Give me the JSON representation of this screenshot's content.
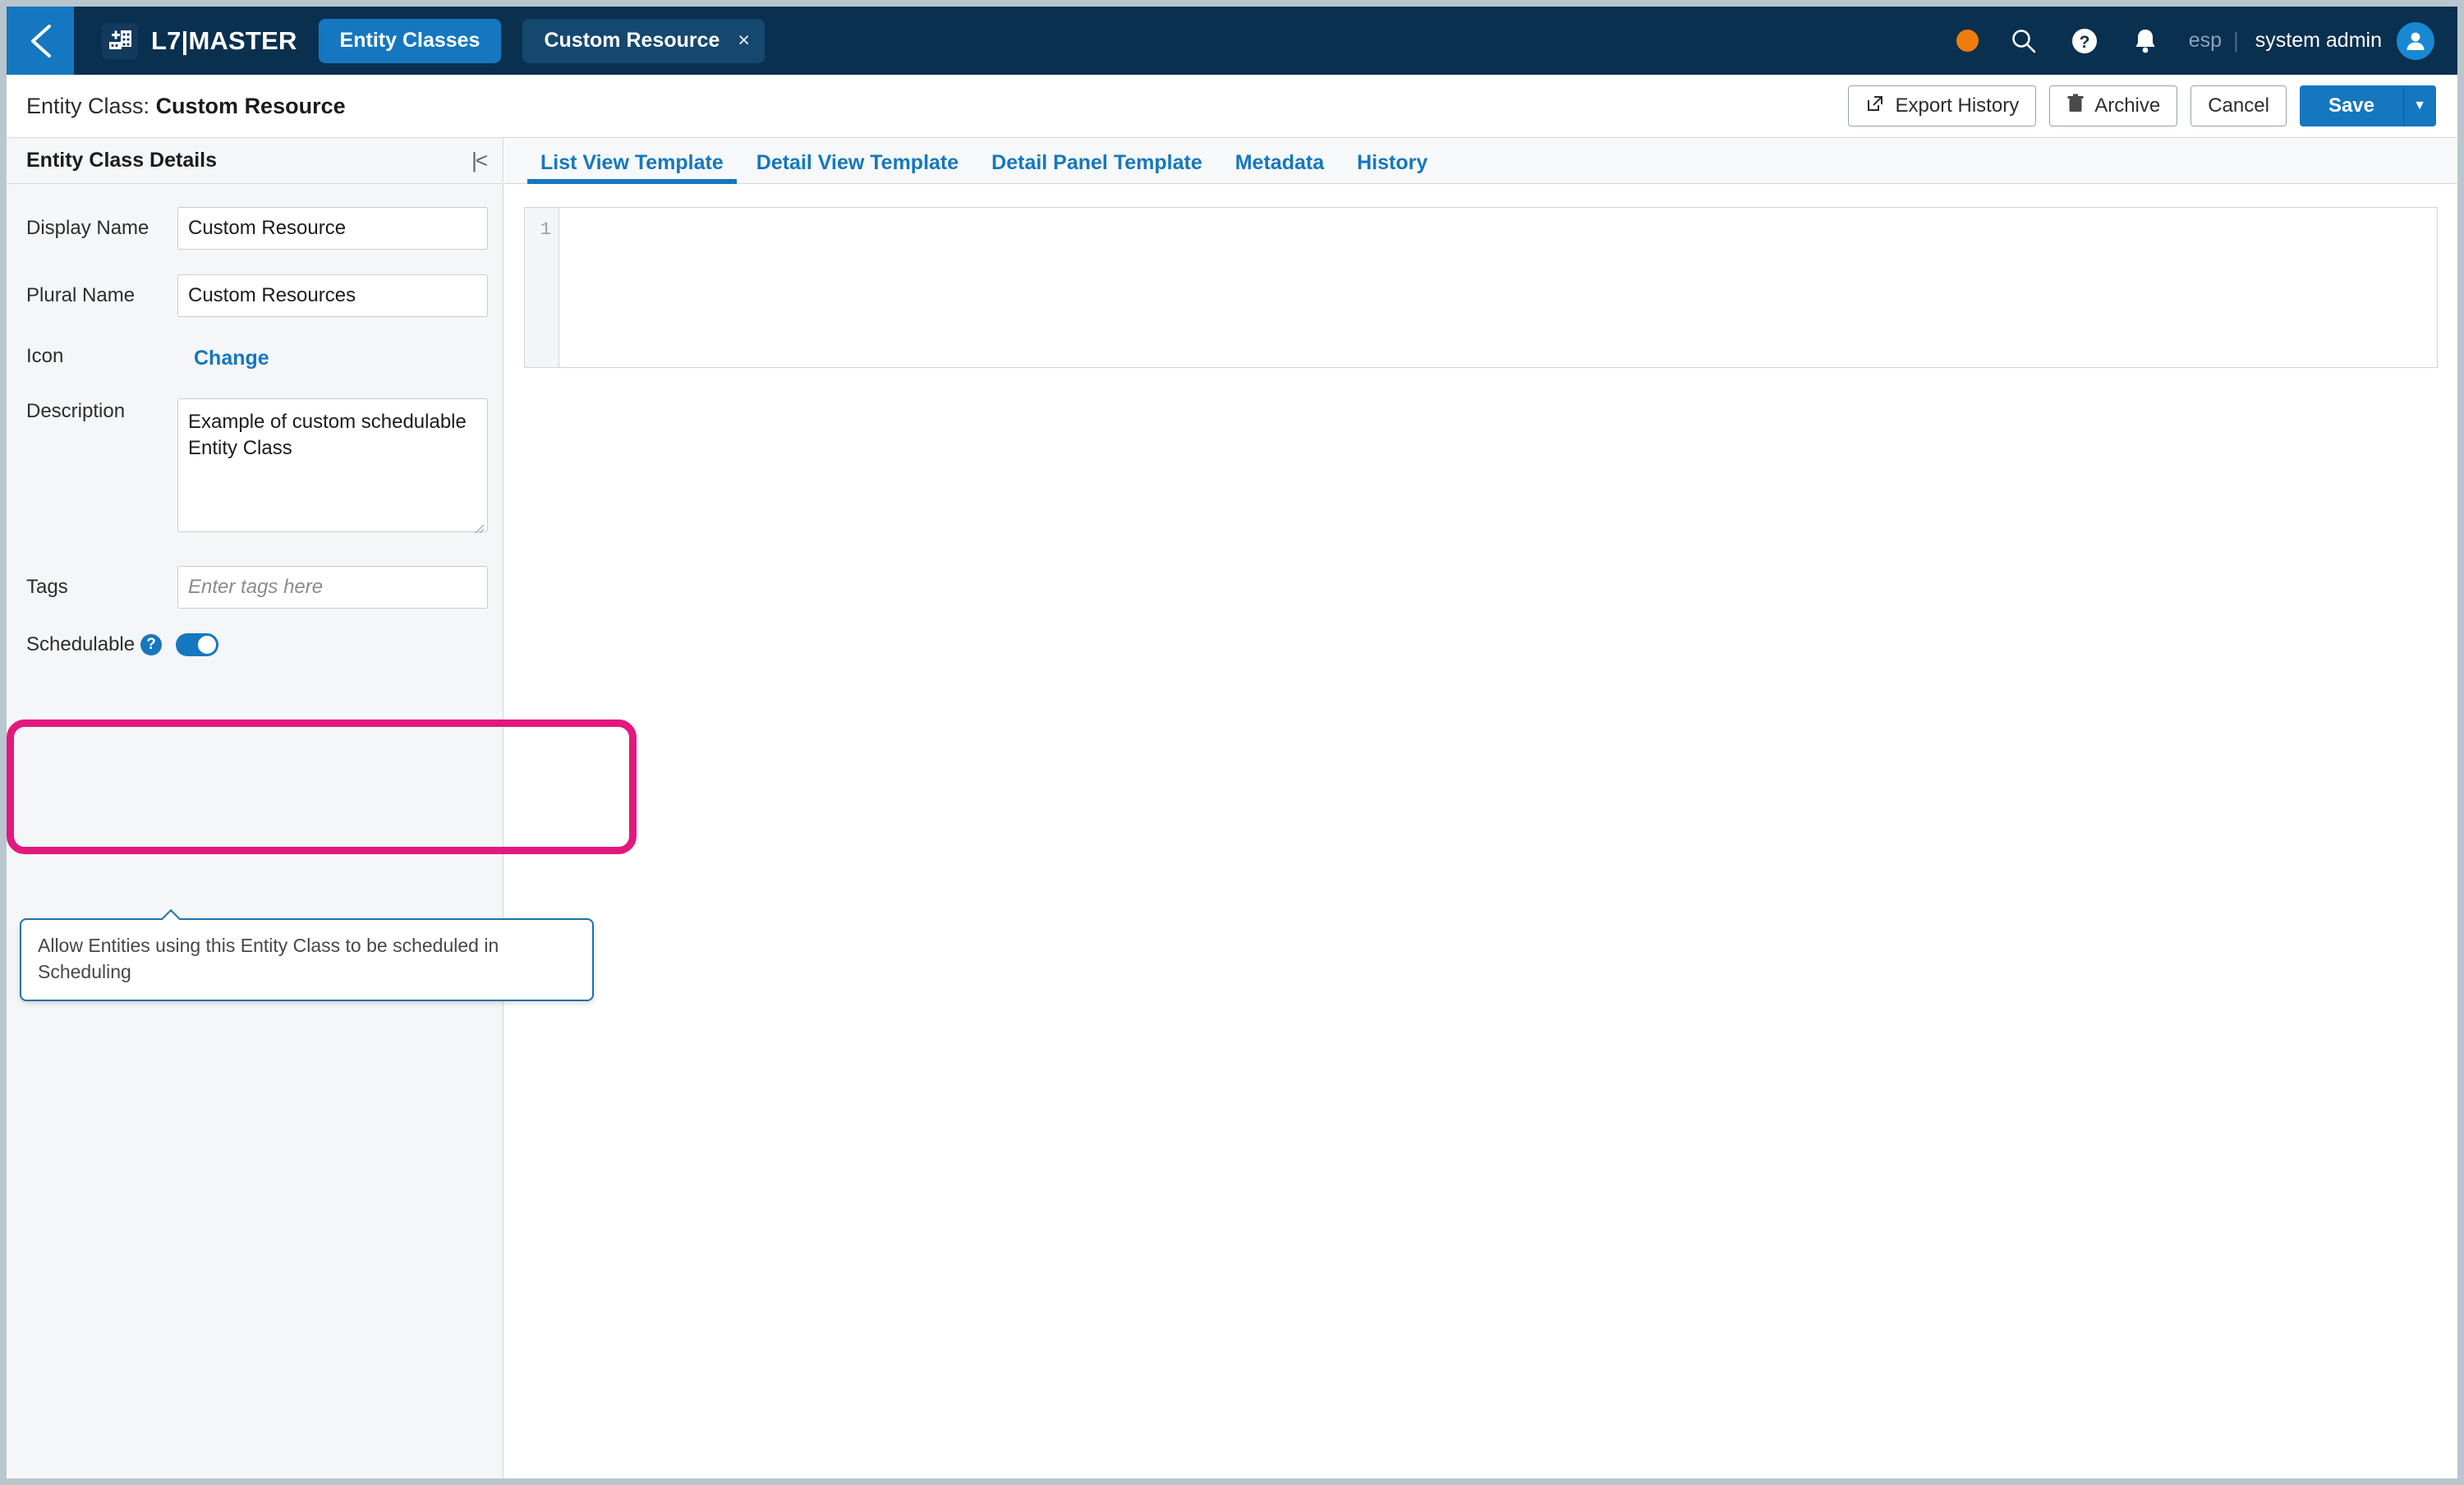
{
  "topbar": {
    "back_icon": "chevron-left-icon",
    "logo_icon": "lab-building-icon",
    "brand": "L7|MASTER",
    "nav_tab": "Entity Classes",
    "doc_tab": "Custom Resource",
    "doc_tab_close": "×",
    "status_dot_color": "#ef7d0e",
    "search_icon": "search-icon",
    "help_icon": "help-circle-icon",
    "notification_icon": "bell-icon",
    "tenant": "esp",
    "separator": "|",
    "user": "system admin",
    "avatar_icon": "user-avatar-icon"
  },
  "subbar": {
    "title_prefix": "Entity Class:",
    "title_value": "Custom Resource",
    "export_history": "Export History",
    "archive": "Archive",
    "cancel": "Cancel",
    "save": "Save",
    "save_caret": "▼",
    "export_icon": "external-link-icon",
    "archive_icon": "trash-icon"
  },
  "left_panel": {
    "header": "Entity Class Details",
    "collapse_icon": "collapse-panel-icon",
    "fields": {
      "display_name_label": "Display Name",
      "display_name_value": "Custom Resource",
      "plural_name_label": "Plural Name",
      "plural_name_value": "Custom Resources",
      "icon_label": "Icon",
      "icon_change_link": "Change",
      "description_label": "Description",
      "description_value": "Example of custom schedulable Entity Class",
      "tags_label": "Tags",
      "tags_value": "",
      "tags_placeholder": "Enter tags here",
      "schedulable_label": "Schedulable",
      "schedulable_help_glyph": "?",
      "schedulable_on": "true"
    },
    "tooltip": {
      "text": "Allow Entities using this Entity Class to be scheduled in Scheduling"
    }
  },
  "main_panel": {
    "tabs": [
      {
        "label": "List View Template",
        "active": true
      },
      {
        "label": "Detail View Template",
        "active": false
      },
      {
        "label": "Detail Panel Template",
        "active": false
      },
      {
        "label": "Metadata",
        "active": false
      },
      {
        "label": "History",
        "active": false
      }
    ],
    "editor": {
      "line_number": "1",
      "content": ""
    }
  },
  "annotation": {
    "highlight_color": "#e3187f",
    "target": "schedulable-field-group"
  },
  "colors": {
    "topbar_bg": "#0a3050",
    "accent_blue": "#1577bf",
    "panel_bg": "#f5f6f7",
    "orange": "#ef7d0e"
  }
}
